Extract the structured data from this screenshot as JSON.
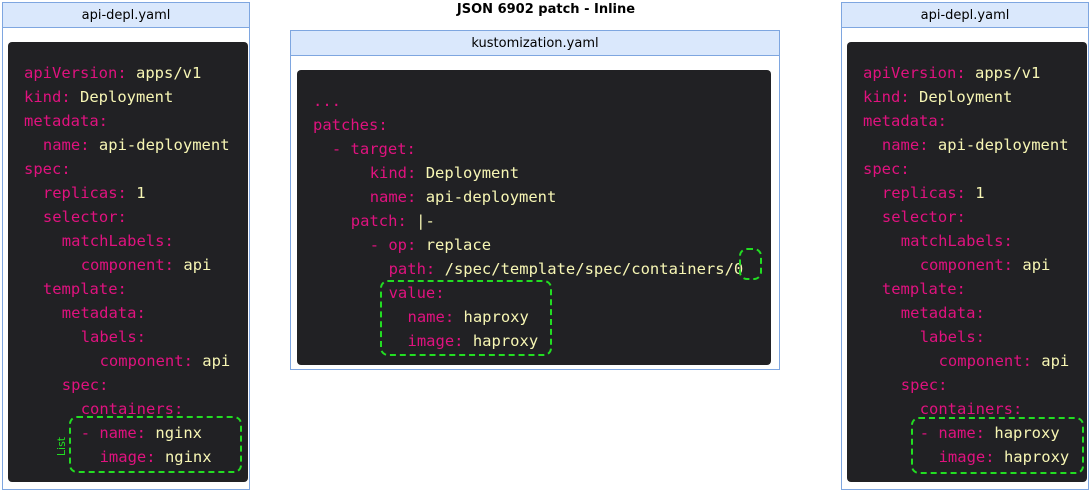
{
  "title": "JSON 6902 patch - Inline",
  "left": {
    "filename": "api-depl.yaml",
    "lines": [
      {
        "k": "apiVersion:",
        "v": "apps/v1"
      },
      {
        "k": "kind:",
        "v": "Deployment"
      },
      {
        "k": "metadata:",
        "v": ""
      },
      {
        "k": "name:",
        "v": "api-deployment"
      },
      {
        "k": "spec:",
        "v": ""
      },
      {
        "k": "replicas:",
        "v": "1"
      },
      {
        "k": "selector:",
        "v": ""
      },
      {
        "k": "matchLabels:",
        "v": ""
      },
      {
        "k": "component:",
        "v": "api"
      },
      {
        "k": "template:",
        "v": ""
      },
      {
        "k": "metadata:",
        "v": ""
      },
      {
        "k": "labels:",
        "v": ""
      },
      {
        "k": "component:",
        "v": "api"
      },
      {
        "k": "spec:",
        "v": ""
      },
      {
        "k": "containers:",
        "v": ""
      },
      {
        "k": "- name:",
        "v": "nginx"
      },
      {
        "k": "image:",
        "v": "nginx"
      }
    ],
    "annotation": "List"
  },
  "middle": {
    "filename": "kustomization.yaml",
    "lines": [
      {
        "k": "...",
        "v": ""
      },
      {
        "k": "patches:",
        "v": ""
      },
      {
        "k": "- target:",
        "v": ""
      },
      {
        "k": "kind:",
        "v": "Deployment"
      },
      {
        "k": "name:",
        "v": "api-deployment"
      },
      {
        "k": "patch:",
        "v": "|-"
      },
      {
        "k": "- op:",
        "v": "replace"
      },
      {
        "k": "path:",
        "v": "/spec/template/spec/containers/0"
      },
      {
        "k": "value:",
        "v": ""
      },
      {
        "k": "name:",
        "v": "haproxy"
      },
      {
        "k": "image:",
        "v": "haproxy"
      }
    ]
  },
  "right": {
    "filename": "api-depl.yaml",
    "lines": [
      {
        "k": "apiVersion:",
        "v": "apps/v1"
      },
      {
        "k": "kind:",
        "v": "Deployment"
      },
      {
        "k": "metadata:",
        "v": ""
      },
      {
        "k": "name:",
        "v": "api-deployment"
      },
      {
        "k": "spec:",
        "v": ""
      },
      {
        "k": "replicas:",
        "v": "1"
      },
      {
        "k": "selector:",
        "v": ""
      },
      {
        "k": "matchLabels:",
        "v": ""
      },
      {
        "k": "component:",
        "v": "api"
      },
      {
        "k": "template:",
        "v": ""
      },
      {
        "k": "metadata:",
        "v": ""
      },
      {
        "k": "labels:",
        "v": ""
      },
      {
        "k": "component:",
        "v": "api"
      },
      {
        "k": "spec:",
        "v": ""
      },
      {
        "k": "containers:",
        "v": ""
      },
      {
        "k": "- name:",
        "v": "haproxy"
      },
      {
        "k": "image:",
        "v": "haproxy"
      }
    ]
  },
  "colors": {
    "key": "#e0127f",
    "value": "#f7f6b4",
    "highlight": "#22dd22",
    "header": "#dae8fc",
    "border": "#7ea6e0",
    "code_bg": "#212124"
  }
}
